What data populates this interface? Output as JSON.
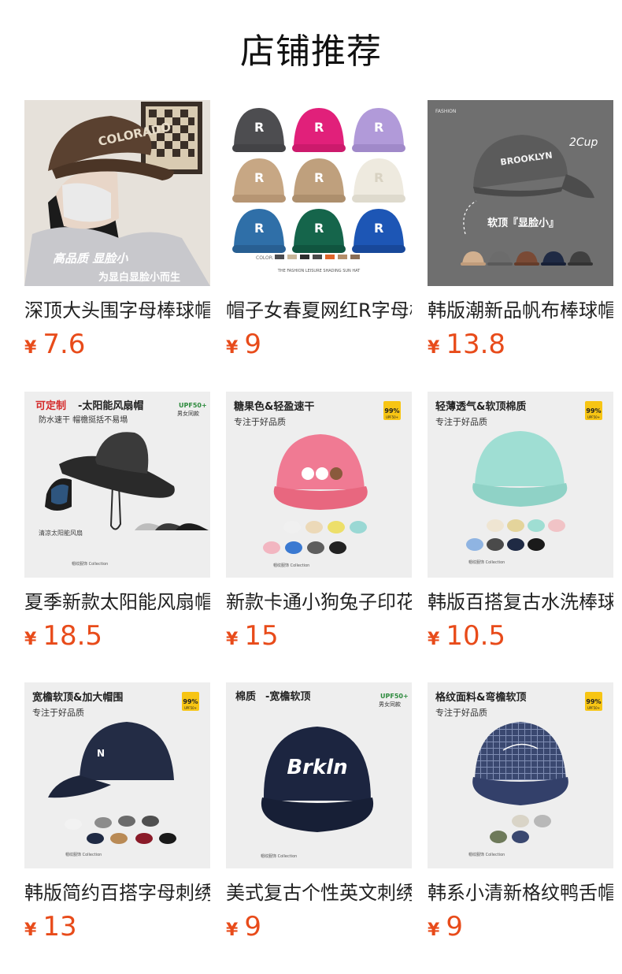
{
  "page": {
    "title": "店铺推荐"
  },
  "currency_symbol": "¥",
  "products": [
    {
      "name": "深顶大头围字母棒球帽",
      "price": "7.6",
      "image": {
        "tagline": "高品质 显脸小",
        "subline": "为显白显脸小而生",
        "hat_text": "COLORADO",
        "bg": "#e9e5df",
        "hat_color": "#5a4130"
      }
    },
    {
      "name": "帽子女春夏网红R字母棒球帽",
      "price": "9",
      "image": {
        "caption": "THE FASHION LEISURE SHADING SUN HAT",
        "color_label": "COLOR:",
        "hat_letter": "R",
        "hat_colors": [
          "#4d4d50",
          "#e1207a",
          "#b19ad9",
          "#c7a784",
          "#bfa07d",
          "#eeeadf",
          "#2f6fa8",
          "#15654b",
          "#1d56b5"
        ]
      }
    },
    {
      "name": "韩版潮新品帆布棒球帽",
      "price": "13.8",
      "image": {
        "brand": "FASHION",
        "hat_text": "BROOKLYN",
        "script_text": "2Cup",
        "label": "软顶『显脸小』",
        "bg": "#6f6f6f",
        "hat_color": "#5b5b5b",
        "swatches": [
          "#d2b08f",
          "#6c6c6c",
          "#7a4a35",
          "#1f2a44",
          "#404040"
        ]
      }
    },
    {
      "name": "夏季新款太阳能风扇帽",
      "price": "18.5",
      "image": {
        "headline_accent": "可定制",
        "headline": "-太阳能风扇帽",
        "sub": "防水速干 帽檐挺括不易塌",
        "badge": "UPF50+",
        "badge_sub": "男女同款",
        "fan_label": "清凉太阳能风扇",
        "footer": "帽纹服饰 Collection",
        "hat_color": "#2a2a2a"
      }
    },
    {
      "name": "新款卡通小狗兔子印花棒球帽",
      "price": "15",
      "image": {
        "headline": "糖果色&轻盈速干",
        "sub": "专注于好品质",
        "badge": "99%",
        "badge_sub": "UPF50+",
        "footer": "帽纹服饰 Collection",
        "hat_color": "#f07a93",
        "swatches": [
          "#f0f0f0",
          "#ecd9b8",
          "#eddf6a",
          "#9ad8d4",
          "#f2b6c1",
          "#3a79d1",
          "#5e5e5e",
          "#222222"
        ]
      }
    },
    {
      "name": "韩版百搭复古水洗棒球帽",
      "price": "10.5",
      "image": {
        "headline": "轻薄透气&软顶棉质",
        "sub": "专注于好品质",
        "badge": "99%",
        "badge_sub": "UPF50+",
        "footer": "帽纹服饰 Collection",
        "hat_color": "#9fded3",
        "swatches": [
          "#efe5d2",
          "#e4d49b",
          "#9fded3",
          "#f1c3c6",
          "#8fb4e2",
          "#4a4a4a",
          "#1f2a44",
          "#1a1a1a"
        ]
      }
    },
    {
      "name": "韩版简约百搭字母刺绣棒球帽",
      "price": "13",
      "image": {
        "headline": "宽檐软顶&加大帽围",
        "sub": "专注于好品质",
        "badge": "99%",
        "badge_sub": "UPF50+",
        "footer": "帽纹服饰 Collection",
        "hat_letter": "N",
        "hat_color": "#232c45",
        "swatches": [
          "#f2f2f2",
          "#8c8c8c",
          "#6b6b6b",
          "#4f4f4f",
          "#1f2a44",
          "#b98a55",
          "#8a1a28",
          "#1a1a1a"
        ]
      }
    },
    {
      "name": "美式复古个性英文刺绣棒球帽",
      "price": "9",
      "image": {
        "headline_accent": "棉质",
        "headline": "-宽檐软顶",
        "badge": "UPF50+",
        "badge_sub": "男女同款",
        "footer": "帽纹服饰 Collection",
        "hat_text": "Brkln",
        "hat_color": "#1c2540"
      }
    },
    {
      "name": "韩系小清新格纹鸭舌帽",
      "price": "9",
      "image": {
        "headline": "格纹面料&弯檐软顶",
        "sub": "专注于好品质",
        "badge": "99%",
        "badge_sub": "UPF50+",
        "footer": "帽纹服饰 Collection",
        "hat_color": "#3a4870",
        "swatches": [
          "#d9d4c7",
          "#b8b8b8",
          "#6e7a5a",
          "#3a4870"
        ]
      }
    }
  ]
}
